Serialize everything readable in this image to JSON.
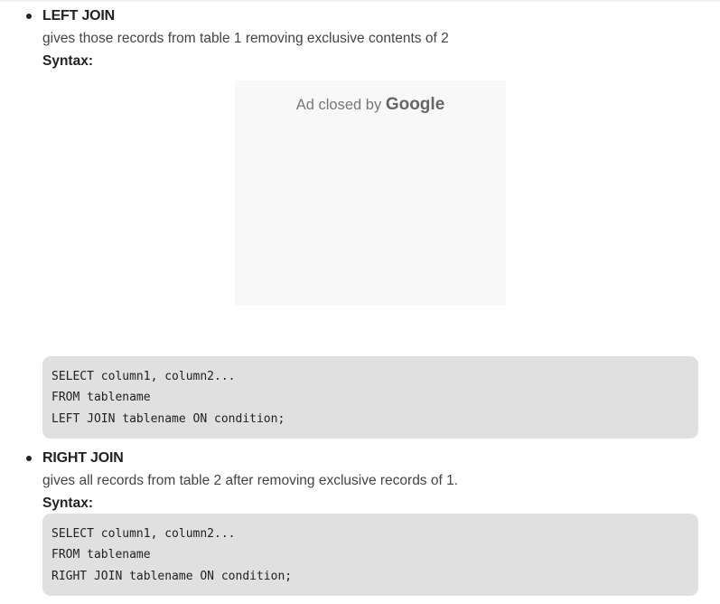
{
  "sections": [
    {
      "title": "LEFT JOIN",
      "description": "gives those records from table 1 removing exclusive contents of 2",
      "syntax_label": "Syntax:",
      "code": "SELECT column1, column2...\nFROM tablename\nLEFT JOIN tablename ON condition;"
    },
    {
      "title": "RIGHT JOIN",
      "description": "gives all records from table 2 after removing exclusive records of 1.",
      "syntax_label": "Syntax:",
      "code": "SELECT column1, column2...\nFROM tablename\nRIGHT JOIN tablename ON condition;"
    }
  ],
  "ad": {
    "text": "Ad closed by",
    "brand": "Google"
  },
  "colors": {
    "code_background": "#e0e0e0",
    "ad_background": "#f8f8f8",
    "text": "#444444",
    "heading": "#222222"
  }
}
